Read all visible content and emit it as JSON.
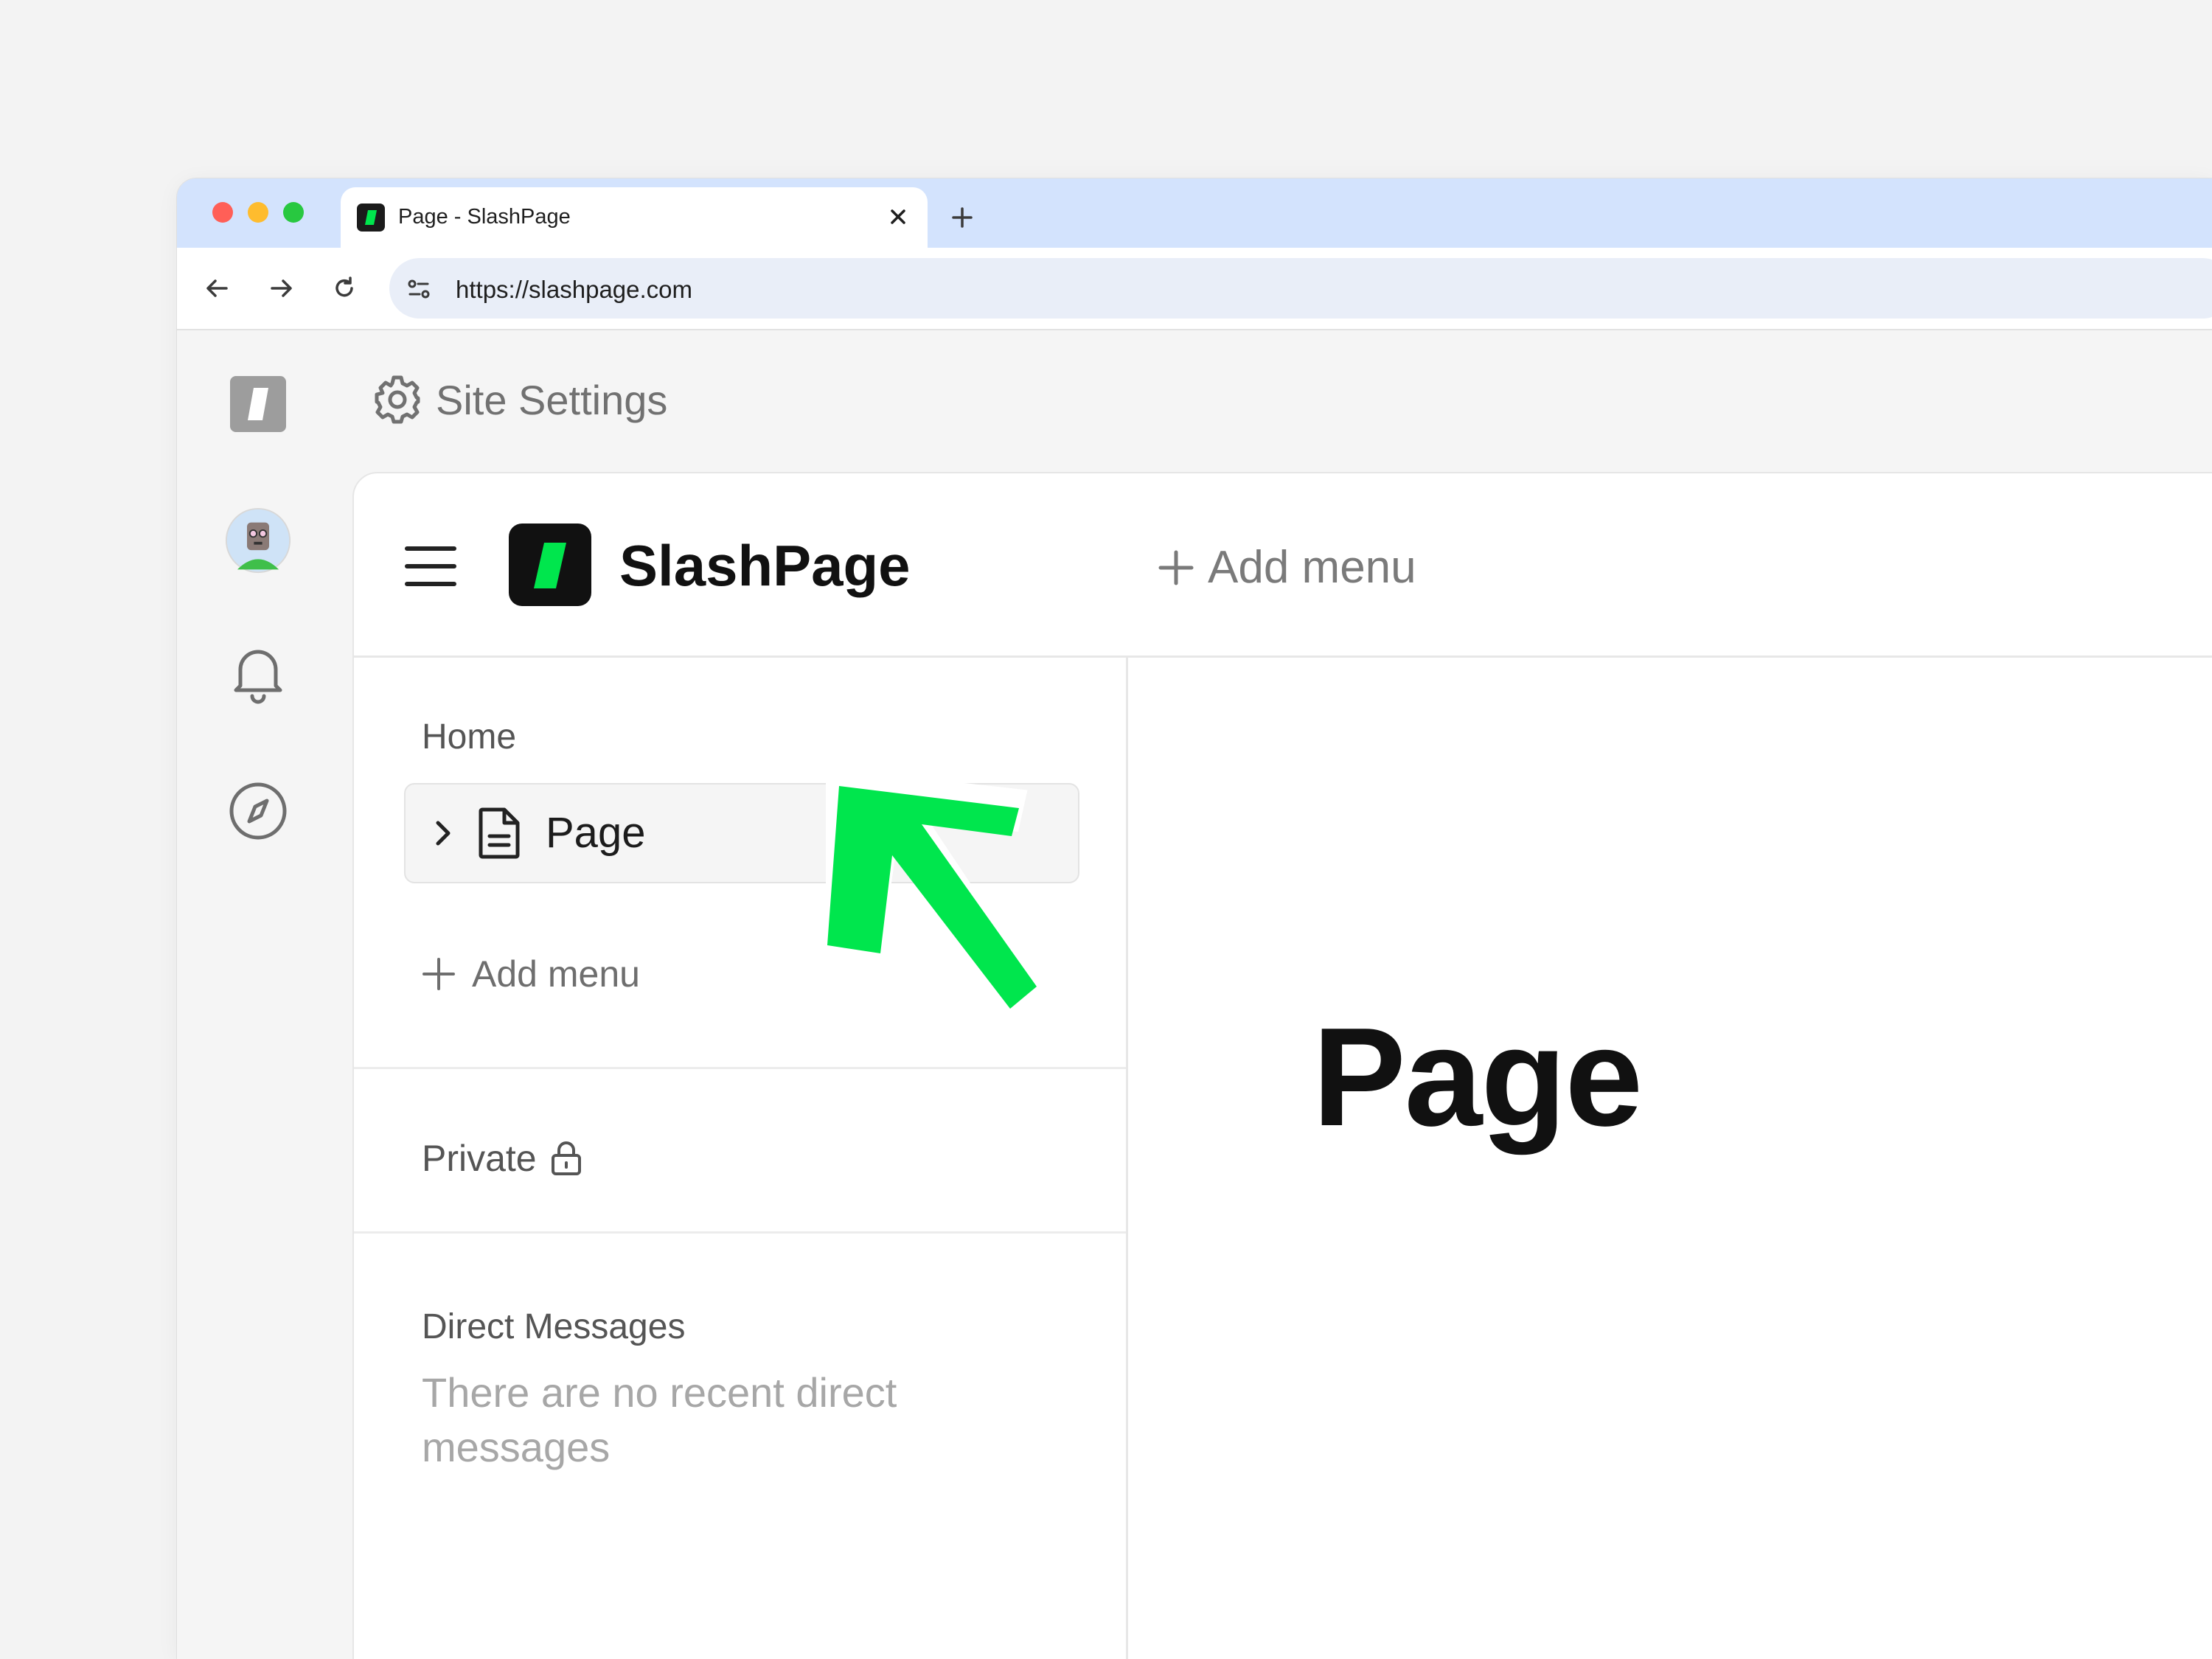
{
  "browser": {
    "tab_title": "Page - SlashPage",
    "url": "https://slashpage.com",
    "traffic_colors": [
      "#ff5f57",
      "#febc2e",
      "#28c840"
    ]
  },
  "top_bar": {
    "settings_label": "Site Settings"
  },
  "site": {
    "brand_name": "SlashPage",
    "header_add_menu": "Add menu",
    "brand_accent": "#00e64d"
  },
  "sidebar": {
    "home_label": "Home",
    "page_item_label": "Page",
    "add_menu_label": "Add menu",
    "private_label": "Private",
    "dm_label": "Direct Messages",
    "dm_empty": "There are no recent direct messages"
  },
  "main": {
    "heading": "Page"
  },
  "icons": {
    "rail": [
      "slashpage-logo-icon",
      "avatar",
      "bell-icon",
      "compass-icon"
    ],
    "annotation": "green-arrow-icon"
  }
}
